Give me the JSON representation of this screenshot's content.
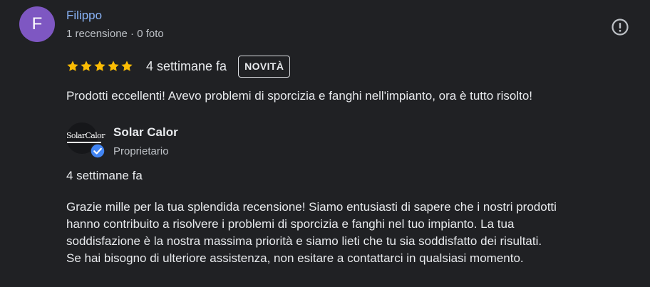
{
  "review": {
    "author": {
      "initial": "F",
      "name": "Filippo",
      "meta": "1 recensione · 0 foto",
      "avatar_color": "#7e57c2"
    },
    "report_icon": "alert-circle-icon",
    "rating": 5,
    "rating_max": 5,
    "star_color": "#fbbc04",
    "time": "4 settimane fa",
    "badge": "NOVITÀ",
    "text": "Prodotti eccellenti! Avevo problemi di sporcizia e fanghi nell'impianto, ora è tutto risolto!"
  },
  "owner_reply": {
    "logo_text": "SolarCalor",
    "verified_icon": "verified-badge-icon",
    "verified_color": "#4285f4",
    "name": "Solar Calor",
    "role": "Proprietario",
    "time": "4 settimane fa",
    "lines": [
      "Grazie mille per la tua splendida recensione! Siamo entusiasti di sapere che i nostri prodotti",
      "hanno contribuito a risolvere i problemi di sporcizia e fanghi nel tuo impianto. La tua",
      "soddisfazione è la nostra massima priorità e siamo lieti che tu sia soddisfatto dei risultati.",
      "Se hai bisogno di ulteriore assistenza, non esitare a contattarci in qualsiasi momento."
    ]
  }
}
